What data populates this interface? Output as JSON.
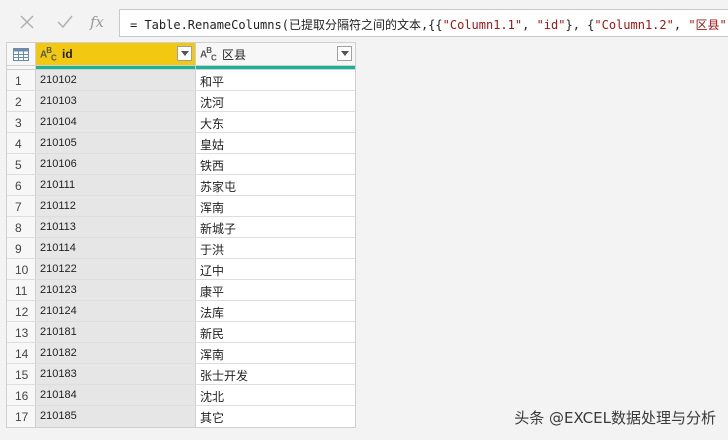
{
  "formula_bar": {
    "cancel_icon": "close-icon",
    "commit_icon": "check-icon",
    "fx_label": "fx",
    "formula_prefix": "= Table.RenameColumns(已提取分隔符之间的文本,{{",
    "formula_s1": "\"Column1.1\"",
    "formula_mid1": ", ",
    "formula_s2": "\"id\"",
    "formula_mid2": "}, {",
    "formula_s3": "\"Column1.2\"",
    "formula_mid3": ", ",
    "formula_s4": "\"区县\"",
    "formula_suffix": "}})"
  },
  "table": {
    "columns": [
      {
        "type_label": "ABC",
        "name": "id"
      },
      {
        "type_label": "ABC",
        "name": "区县"
      }
    ],
    "rows": [
      {
        "n": "1",
        "id": "210102",
        "district": "和平"
      },
      {
        "n": "2",
        "id": "210103",
        "district": "沈河"
      },
      {
        "n": "3",
        "id": "210104",
        "district": "大东"
      },
      {
        "n": "4",
        "id": "210105",
        "district": "皇姑"
      },
      {
        "n": "5",
        "id": "210106",
        "district": "铁西"
      },
      {
        "n": "6",
        "id": "210111",
        "district": "苏家屯"
      },
      {
        "n": "7",
        "id": "210112",
        "district": "浑南"
      },
      {
        "n": "8",
        "id": "210113",
        "district": "新城子"
      },
      {
        "n": "9",
        "id": "210114",
        "district": "于洪"
      },
      {
        "n": "10",
        "id": "210122",
        "district": "辽中"
      },
      {
        "n": "11",
        "id": "210123",
        "district": "康平"
      },
      {
        "n": "12",
        "id": "210124",
        "district": "法库"
      },
      {
        "n": "13",
        "id": "210181",
        "district": "新民"
      },
      {
        "n": "14",
        "id": "210182",
        "district": "浑南"
      },
      {
        "n": "15",
        "id": "210183",
        "district": "张士开发"
      },
      {
        "n": "16",
        "id": "210184",
        "district": "沈北"
      },
      {
        "n": "17",
        "id": "210185",
        "district": "其它"
      }
    ]
  },
  "watermark": "头条 @EXCEL数据处理与分析",
  "colors": {
    "selected_header": "#f2c811",
    "quality_bar": "#1ab394"
  }
}
